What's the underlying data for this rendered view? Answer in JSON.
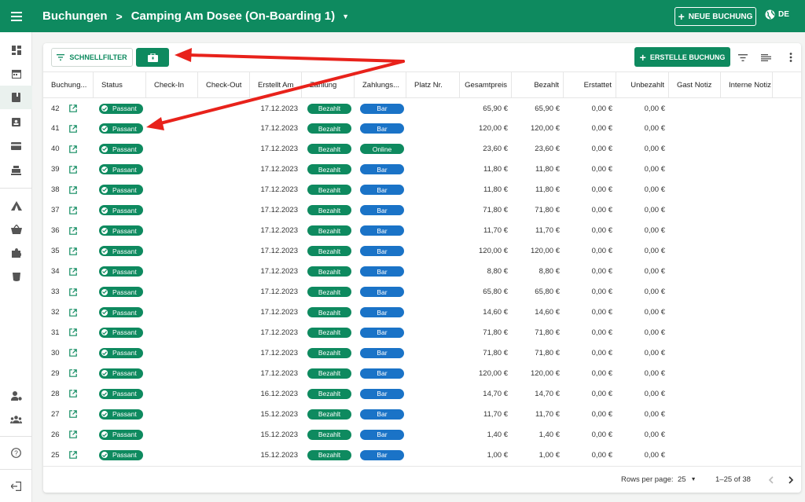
{
  "header": {
    "breadcrumb_root": "Buchungen",
    "breadcrumb_separator": ">",
    "campground": "Camping Am Dosee (On-Boarding 1)",
    "new_booking_label": "NEUE BUCHUNG",
    "language": "DE"
  },
  "sidebar": {
    "items": [
      {
        "icon": "dashboard-icon"
      },
      {
        "icon": "calendar-icon"
      },
      {
        "icon": "book-icon",
        "active": true
      },
      {
        "icon": "clipboard-person-icon"
      },
      {
        "icon": "credit-card-icon"
      },
      {
        "icon": "cash-register-icon"
      },
      {
        "icon": "tent-icon"
      },
      {
        "icon": "basket-icon"
      },
      {
        "icon": "puzzle-icon"
      },
      {
        "icon": "cup-icon"
      },
      {
        "icon": "user-settings-icon"
      },
      {
        "icon": "team-icon"
      },
      {
        "icon": "help-icon"
      },
      {
        "icon": "logout-icon"
      }
    ]
  },
  "toolbar": {
    "quickfilter_label": "SCHNELLFILTER",
    "create_label": "ERSTELLE BUCHUNG"
  },
  "table": {
    "columns": [
      "Buchung...",
      "Status",
      "Check-In",
      "Check-Out",
      "Erstellt Am",
      "Zahlung",
      "Zahlungs...",
      "Platz Nr.",
      "Gesamtpreis",
      "Bezahlt",
      "Erstattet",
      "Unbezahlt",
      "Gast Notiz",
      "Interne Notiz"
    ],
    "rows": [
      {
        "id": "42",
        "status": "Passant",
        "created": "17.12.2023",
        "payment": "Bezahlt",
        "method": "Bar",
        "total": "65,90 €",
        "paid": "65,90 €",
        "refunded": "0,00 €",
        "unpaid": "0,00 €"
      },
      {
        "id": "41",
        "status": "Passant",
        "created": "17.12.2023",
        "payment": "Bezahlt",
        "method": "Bar",
        "total": "120,00 €",
        "paid": "120,00 €",
        "refunded": "0,00 €",
        "unpaid": "0,00 €"
      },
      {
        "id": "40",
        "status": "Passant",
        "created": "17.12.2023",
        "payment": "Bezahlt",
        "method": "Online",
        "total": "23,60 €",
        "paid": "23,60 €",
        "refunded": "0,00 €",
        "unpaid": "0,00 €"
      },
      {
        "id": "39",
        "status": "Passant",
        "created": "17.12.2023",
        "payment": "Bezahlt",
        "method": "Bar",
        "total": "11,80 €",
        "paid": "11,80 €",
        "refunded": "0,00 €",
        "unpaid": "0,00 €"
      },
      {
        "id": "38",
        "status": "Passant",
        "created": "17.12.2023",
        "payment": "Bezahlt",
        "method": "Bar",
        "total": "11,80 €",
        "paid": "11,80 €",
        "refunded": "0,00 €",
        "unpaid": "0,00 €"
      },
      {
        "id": "37",
        "status": "Passant",
        "created": "17.12.2023",
        "payment": "Bezahlt",
        "method": "Bar",
        "total": "71,80 €",
        "paid": "71,80 €",
        "refunded": "0,00 €",
        "unpaid": "0,00 €"
      },
      {
        "id": "36",
        "status": "Passant",
        "created": "17.12.2023",
        "payment": "Bezahlt",
        "method": "Bar",
        "total": "11,70 €",
        "paid": "11,70 €",
        "refunded": "0,00 €",
        "unpaid": "0,00 €"
      },
      {
        "id": "35",
        "status": "Passant",
        "created": "17.12.2023",
        "payment": "Bezahlt",
        "method": "Bar",
        "total": "120,00 €",
        "paid": "120,00 €",
        "refunded": "0,00 €",
        "unpaid": "0,00 €"
      },
      {
        "id": "34",
        "status": "Passant",
        "created": "17.12.2023",
        "payment": "Bezahlt",
        "method": "Bar",
        "total": "8,80 €",
        "paid": "8,80 €",
        "refunded": "0,00 €",
        "unpaid": "0,00 €"
      },
      {
        "id": "33",
        "status": "Passant",
        "created": "17.12.2023",
        "payment": "Bezahlt",
        "method": "Bar",
        "total": "65,80 €",
        "paid": "65,80 €",
        "refunded": "0,00 €",
        "unpaid": "0,00 €"
      },
      {
        "id": "32",
        "status": "Passant",
        "created": "17.12.2023",
        "payment": "Bezahlt",
        "method": "Bar",
        "total": "14,60 €",
        "paid": "14,60 €",
        "refunded": "0,00 €",
        "unpaid": "0,00 €"
      },
      {
        "id": "31",
        "status": "Passant",
        "created": "17.12.2023",
        "payment": "Bezahlt",
        "method": "Bar",
        "total": "71,80 €",
        "paid": "71,80 €",
        "refunded": "0,00 €",
        "unpaid": "0,00 €"
      },
      {
        "id": "30",
        "status": "Passant",
        "created": "17.12.2023",
        "payment": "Bezahlt",
        "method": "Bar",
        "total": "71,80 €",
        "paid": "71,80 €",
        "refunded": "0,00 €",
        "unpaid": "0,00 €"
      },
      {
        "id": "29",
        "status": "Passant",
        "created": "17.12.2023",
        "payment": "Bezahlt",
        "method": "Bar",
        "total": "120,00 €",
        "paid": "120,00 €",
        "refunded": "0,00 €",
        "unpaid": "0,00 €"
      },
      {
        "id": "28",
        "status": "Passant",
        "created": "16.12.2023",
        "payment": "Bezahlt",
        "method": "Bar",
        "total": "14,70 €",
        "paid": "14,70 €",
        "refunded": "0,00 €",
        "unpaid": "0,00 €"
      },
      {
        "id": "27",
        "status": "Passant",
        "created": "15.12.2023",
        "payment": "Bezahlt",
        "method": "Bar",
        "total": "11,70 €",
        "paid": "11,70 €",
        "refunded": "0,00 €",
        "unpaid": "0,00 €"
      },
      {
        "id": "26",
        "status": "Passant",
        "created": "15.12.2023",
        "payment": "Bezahlt",
        "method": "Bar",
        "total": "1,40 €",
        "paid": "1,40 €",
        "refunded": "0,00 €",
        "unpaid": "0,00 €"
      },
      {
        "id": "25",
        "status": "Passant",
        "created": "15.12.2023",
        "payment": "Bezahlt",
        "method": "Bar",
        "total": "1,00 €",
        "paid": "1,00 €",
        "refunded": "0,00 €",
        "unpaid": "0,00 €"
      }
    ]
  },
  "footer": {
    "rows_per_page_label": "Rows per page:",
    "rows_per_page_value": "25",
    "range": "1–25 of 38"
  },
  "colors": {
    "primary": "#0e8a5f",
    "method_bar": "#1a73c7",
    "method_online": "#0e8a5f",
    "annotation_arrow": "#e8221b"
  }
}
